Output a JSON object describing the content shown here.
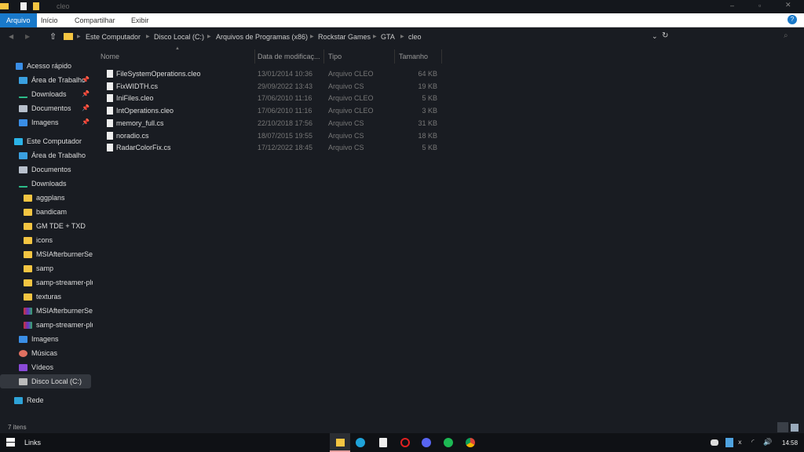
{
  "window": {
    "title": "cleo"
  },
  "ribbon": {
    "tabs": [
      "Arquivo",
      "Início",
      "Compartilhar",
      "Exibir"
    ]
  },
  "breadcrumb": [
    "Este Computador",
    "Disco Local (C:)",
    "Arquivos de Programas (x86)",
    "Rockstar Games",
    "GTA",
    "cleo"
  ],
  "sidebar": {
    "quick_access": {
      "label": "Acesso rápido",
      "items": [
        "Área de Trabalho",
        "Downloads",
        "Documentos",
        "Imagens"
      ]
    },
    "this_pc": {
      "label": "Este Computador",
      "items": [
        {
          "label": "Área de Trabalho",
          "icon": "desktop-icon",
          "indent": 1
        },
        {
          "label": "Documentos",
          "icon": "documents-icon",
          "indent": 1
        },
        {
          "label": "Downloads",
          "icon": "download-icon",
          "indent": 1
        },
        {
          "label": "aggplans",
          "icon": "folder-icon",
          "indent": 2
        },
        {
          "label": "bandicam",
          "icon": "folder-icon",
          "indent": 2
        },
        {
          "label": "GM TDE + TXD",
          "icon": "folder-icon",
          "indent": 2
        },
        {
          "label": "icons",
          "icon": "folder-icon",
          "indent": 2
        },
        {
          "label": "MSIAfterburnerSetup",
          "icon": "folder-icon",
          "indent": 2
        },
        {
          "label": "samp",
          "icon": "folder-icon",
          "indent": 2
        },
        {
          "label": "samp-streamer-plugin",
          "icon": "folder-icon",
          "indent": 2
        },
        {
          "label": "texturas",
          "icon": "folder-icon",
          "indent": 2
        },
        {
          "label": "MSIAfterburnerSetup",
          "icon": "archive-icon",
          "indent": 2
        },
        {
          "label": "samp-streamer-plugin",
          "icon": "archive-icon",
          "indent": 2
        },
        {
          "label": "Imagens",
          "icon": "pictures-icon",
          "indent": 1
        },
        {
          "label": "Músicas",
          "icon": "music-icon",
          "indent": 1
        },
        {
          "label": "Vídeos",
          "icon": "videos-icon",
          "indent": 1
        },
        {
          "label": "Disco Local (C:)",
          "icon": "drive-icon",
          "indent": 1,
          "selected": true
        }
      ]
    },
    "network": {
      "label": "Rede"
    }
  },
  "columns": [
    "Nome",
    "Data de modificaç...",
    "Tipo",
    "Tamanho"
  ],
  "files": [
    {
      "name": "FileSystemOperations.cleo",
      "date": "13/01/2014 10:36",
      "type": "Arquivo CLEO",
      "size": "64 KB"
    },
    {
      "name": "FixWIDTH.cs",
      "date": "29/09/2022 13:43",
      "type": "Arquivo CS",
      "size": "19 KB"
    },
    {
      "name": "IniFiles.cleo",
      "date": "17/06/2010 11:16",
      "type": "Arquivo CLEO",
      "size": "5 KB"
    },
    {
      "name": "IntOperations.cleo",
      "date": "17/06/2010 11:16",
      "type": "Arquivo CLEO",
      "size": "3 KB"
    },
    {
      "name": "memory_full.cs",
      "date": "22/10/2018 17:56",
      "type": "Arquivo CS",
      "size": "31 KB"
    },
    {
      "name": "noradio.cs",
      "date": "18/07/2015 19:55",
      "type": "Arquivo CS",
      "size": "18 KB"
    },
    {
      "name": "RadarColorFix.cs",
      "date": "17/12/2022 18:45",
      "type": "Arquivo CS",
      "size": "5 KB"
    }
  ],
  "status": {
    "count": "7 itens"
  },
  "taskbar": {
    "links": "Links",
    "clock": "14:58"
  },
  "colors": {
    "accent": "#1979ca",
    "folder": "#f4c542"
  }
}
